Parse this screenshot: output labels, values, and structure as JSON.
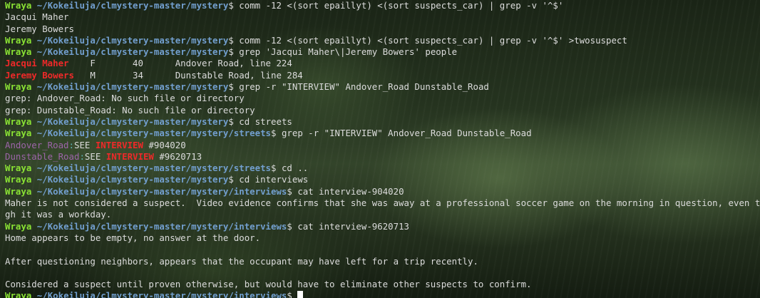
{
  "prompt": {
    "user": "Wraya",
    "symbol": "$"
  },
  "lines": [
    {
      "path": "~/Kokeiluja/clmystery-master/mystery",
      "cmd": "comm -12 <(sort epaillyt) <(sort suspects_car) | grep -v '^$'"
    },
    {
      "text": "Jacqui Maher"
    },
    {
      "text": "Jeremy Bowers"
    },
    {
      "path": "~/Kokeiluja/clmystery-master/mystery",
      "cmd": "comm -12 <(sort epaillyt) <(sort suspects_car) | grep -v '^$' >twosuspect"
    },
    {
      "path": "~/Kokeiluja/clmystery-master/mystery",
      "cmd": "grep 'Jacqui Maher\\|Jeremy Bowers' people"
    },
    {
      "match": "Jacqui Maher",
      "rest": "    F       40      Andover Road, line 224"
    },
    {
      "match": "Jeremy Bowers",
      "rest": "   M       34      Dunstable Road, line 284"
    },
    {
      "path": "~/Kokeiluja/clmystery-master/mystery",
      "cmd": "grep -r \"INTERVIEW\" Andover_Road Dunstable_Road"
    },
    {
      "text": "grep: Andover_Road: No such file or directory"
    },
    {
      "text": "grep: Dunstable_Road: No such file or directory"
    },
    {
      "path": "~/Kokeiluja/clmystery-master/mystery",
      "cmd": "cd streets"
    },
    {
      "path": "~/Kokeiluja/clmystery-master/mystery/streets",
      "cmd": "grep -r \"INTERVIEW\" Andover_Road Dunstable_Road"
    },
    {
      "file": "Andover_Road",
      "pre": "SEE ",
      "match": "INTERVIEW",
      "post": " #904020"
    },
    {
      "file": "Dunstable_Road",
      "pre": "SEE ",
      "match": "INTERVIEW",
      "post": " #9620713"
    },
    {
      "path": "~/Kokeiluja/clmystery-master/mystery/streets",
      "cmd": "cd .."
    },
    {
      "path": "~/Kokeiluja/clmystery-master/mystery",
      "cmd": "cd interviews"
    },
    {
      "path": "~/Kokeiluja/clmystery-master/mystery/interviews",
      "cmd": "cat interview-904020"
    },
    {
      "text": "Maher is not considered a suspect.  Video evidence confirms that she was away at a professional soccer game on the morning in question, even thou"
    },
    {
      "text": "gh it was a workday."
    },
    {
      "path": "~/Kokeiluja/clmystery-master/mystery/interviews",
      "cmd": "cat interview-9620713"
    },
    {
      "text": "Home appears to be empty, no answer at the door."
    },
    {
      "text": ""
    },
    {
      "text": "After questioning neighbors, appears that the occupant may have left for a trip recently."
    },
    {
      "text": ""
    },
    {
      "text": "Considered a suspect until proven otherwise, but would have to eliminate other suspects to confirm."
    },
    {
      "path": "~/Kokeiluja/clmystery-master/mystery/interviews",
      "cmd": "",
      "cursor": true
    }
  ]
}
